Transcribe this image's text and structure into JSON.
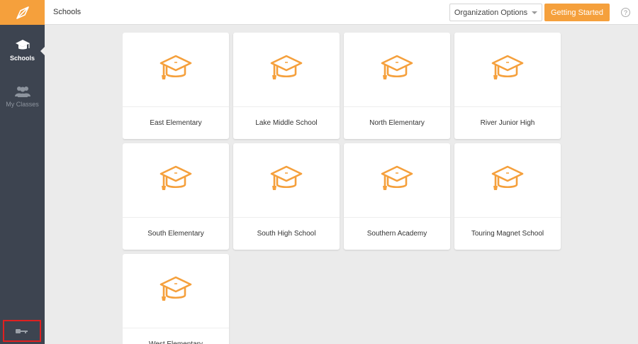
{
  "app": {
    "logo": "compass-logo-icon",
    "accent_color": "#f5a03c",
    "sidebar_color": "#3d4450"
  },
  "sidebar": {
    "items": [
      {
        "label": "Schools",
        "icon": "graduation-cap-icon",
        "active": true
      },
      {
        "label": "My Classes",
        "icon": "group-icon",
        "active": false
      }
    ],
    "logout_icon": "key-icon"
  },
  "header": {
    "title": "Schools",
    "org_options_label": "Organization Options",
    "getting_started_label": "Getting Started",
    "help_icon": "?"
  },
  "schools": [
    {
      "name": "East Elementary"
    },
    {
      "name": "Lake Middle School"
    },
    {
      "name": "North Elementary"
    },
    {
      "name": "River Junior High"
    },
    {
      "name": "South Elementary"
    },
    {
      "name": "South High School"
    },
    {
      "name": "Southern Academy"
    },
    {
      "name": "Touring Magnet School"
    },
    {
      "name": "West Elementary"
    }
  ]
}
